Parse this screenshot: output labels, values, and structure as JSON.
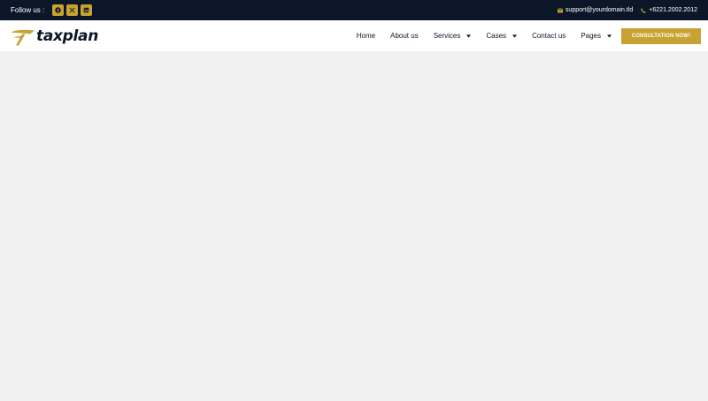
{
  "topbar": {
    "follow_label": "Follow us :",
    "social": [
      {
        "icon": "facebook-icon"
      },
      {
        "icon": "x-twitter-icon"
      },
      {
        "icon": "linkedin-icon"
      }
    ],
    "email": "support@yourdomain.tld",
    "phone": "+6221.2002.2012"
  },
  "brand": {
    "name": "taxplan",
    "accent_color": "#c8a233",
    "dark_color": "#0b1728"
  },
  "nav": {
    "items": [
      {
        "label": "Home",
        "dropdown": false
      },
      {
        "label": "About us",
        "dropdown": false
      },
      {
        "label": "Services",
        "dropdown": true
      },
      {
        "label": "Cases",
        "dropdown": true
      },
      {
        "label": "Contact us",
        "dropdown": false
      },
      {
        "label": "Pages",
        "dropdown": true
      }
    ],
    "cta_label": "CONSULTATION NOW!"
  }
}
